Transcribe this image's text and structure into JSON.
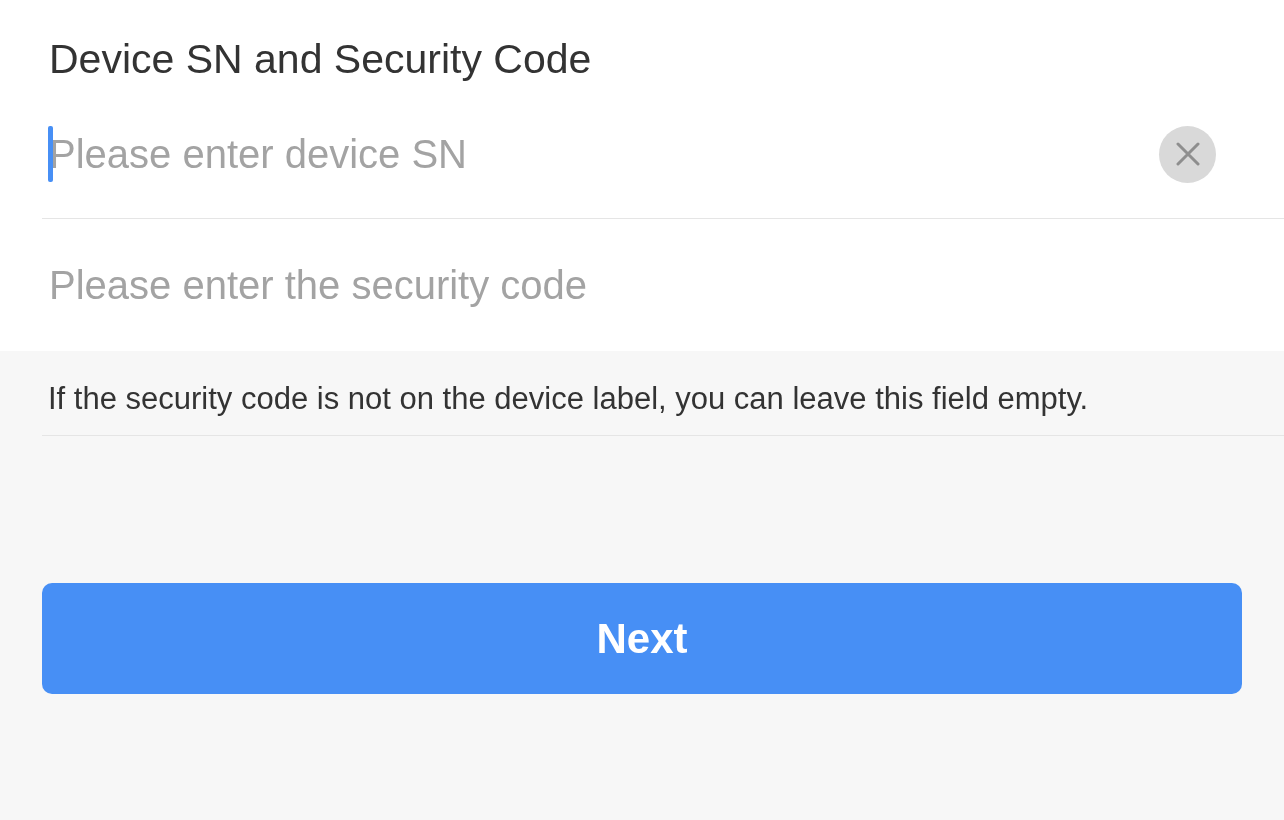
{
  "title": "Device SN and Security Code",
  "fields": [
    {
      "placeholder": "Please enter device SN",
      "focused": true
    },
    {
      "placeholder": "Please enter the security code",
      "focused": false
    }
  ],
  "hint": "If the security code is not on the device label, you can leave this field empty.",
  "button": {
    "label": "Next"
  }
}
